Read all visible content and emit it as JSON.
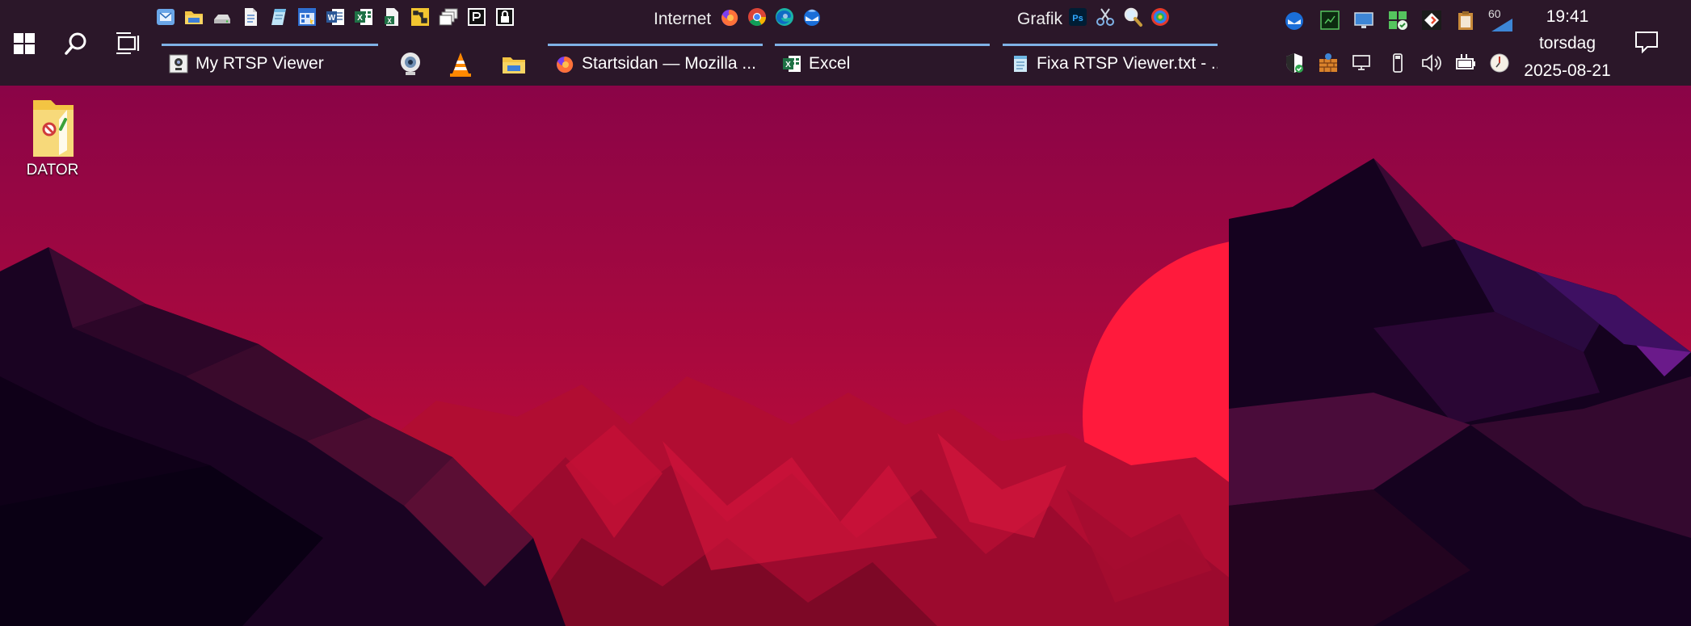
{
  "taskbar": {
    "group_labels": {
      "internet": "Internet",
      "graphics": "Grafik"
    },
    "windows": [
      {
        "label": "My RTSP Viewer",
        "icon": "camera-viewer-icon"
      },
      {
        "label": "Startsidan — Mozilla ...",
        "icon": "firefox-icon"
      },
      {
        "label": "Excel",
        "icon": "excel-icon"
      },
      {
        "label": "Fixa RTSP Viewer.txt - ...",
        "icon": "notepad-icon"
      }
    ],
    "pinned_apps": [
      "webcam-icon",
      "vlc-icon",
      "file-explorer-icon"
    ],
    "tray": {
      "battery_percent_label": "60"
    },
    "clock": {
      "time": "19:41",
      "weekday": "torsdag",
      "date": "2025-08-21"
    }
  },
  "desktop": {
    "icons": [
      {
        "label": "DATOR",
        "icon": "folder-pc-icon"
      }
    ]
  },
  "colors": {
    "taskbar_bg": "#2b1729",
    "active_underline": "#7fb1e6",
    "wallpaper_sky_top": "#8a0447",
    "wallpaper_sky_bottom": "#c80a35",
    "sun": "#ff1a3c"
  }
}
